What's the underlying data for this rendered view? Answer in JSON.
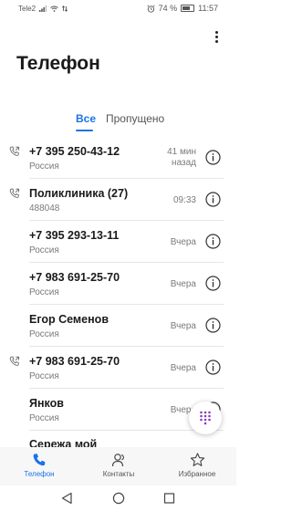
{
  "status_bar": {
    "carrier": "Tele2",
    "battery": "74 %",
    "time": "11:57"
  },
  "header": {
    "title": "Телефон",
    "more_icon": "more-vert-icon"
  },
  "tabs": [
    {
      "label": "Все",
      "selected": true
    },
    {
      "label": "Пропущено",
      "selected": false
    }
  ],
  "calls": [
    {
      "name": "+7 395 250-43-12",
      "sub": "Россия",
      "time": "41 мин назад",
      "time_line1": "41 мин",
      "time_line2": "назад",
      "has_call_icon": true
    },
    {
      "name": "Поликлиника (27)",
      "sub": "488048",
      "time": "09:33",
      "has_call_icon": true
    },
    {
      "name": "+7 395 293-13-11",
      "sub": "Россия",
      "time": "Вчера",
      "has_call_icon": false
    },
    {
      "name": "+7 983 691-25-70",
      "sub": "Россия",
      "time": "Вчера",
      "has_call_icon": false
    },
    {
      "name": "Егор Семенов",
      "sub": "Россия",
      "time": "Вчера",
      "has_call_icon": false
    },
    {
      "name": "+7 983 691-25-70",
      "sub": "Россия",
      "time": "Вчера",
      "has_call_icon": true
    },
    {
      "name": "Янков",
      "sub": "Россия",
      "time": "Вчера",
      "has_call_icon": false
    },
    {
      "name": "Сережа мой",
      "sub": "",
      "time": "",
      "has_call_icon": false
    }
  ],
  "bottom_nav": [
    {
      "label": "Телефон",
      "icon": "phone-icon",
      "active": true
    },
    {
      "label": "Контакты",
      "icon": "contacts-icon",
      "active": false
    },
    {
      "label": "Избранное",
      "icon": "star-icon",
      "active": false
    }
  ],
  "colors": {
    "accent": "#1a73e8",
    "text_primary": "#1a1a1a",
    "text_secondary": "#7a7a7a"
  }
}
